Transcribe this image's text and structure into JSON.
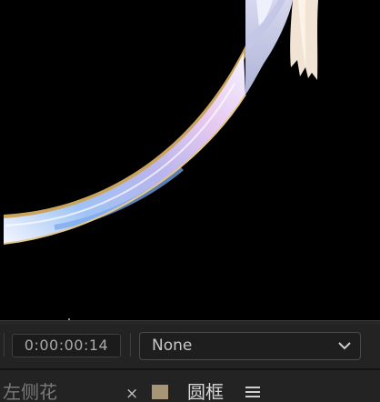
{
  "viewer": {
    "content": "composition-preview"
  },
  "controls": {
    "timecode": "0:00:00:14",
    "resolution_dropdown": {
      "selected": "None",
      "icon": "chevron-down-icon"
    }
  },
  "tabs": {
    "inactive_label": "左侧花",
    "close_symbol": "×",
    "active_label": "圆框",
    "active_color": "#a89578",
    "menu_icon": "hamburger-menu-icon"
  },
  "colors": {
    "viewer_background": "#000000",
    "panel_background": "#232323",
    "timecode_text": "#a9a9a9"
  }
}
